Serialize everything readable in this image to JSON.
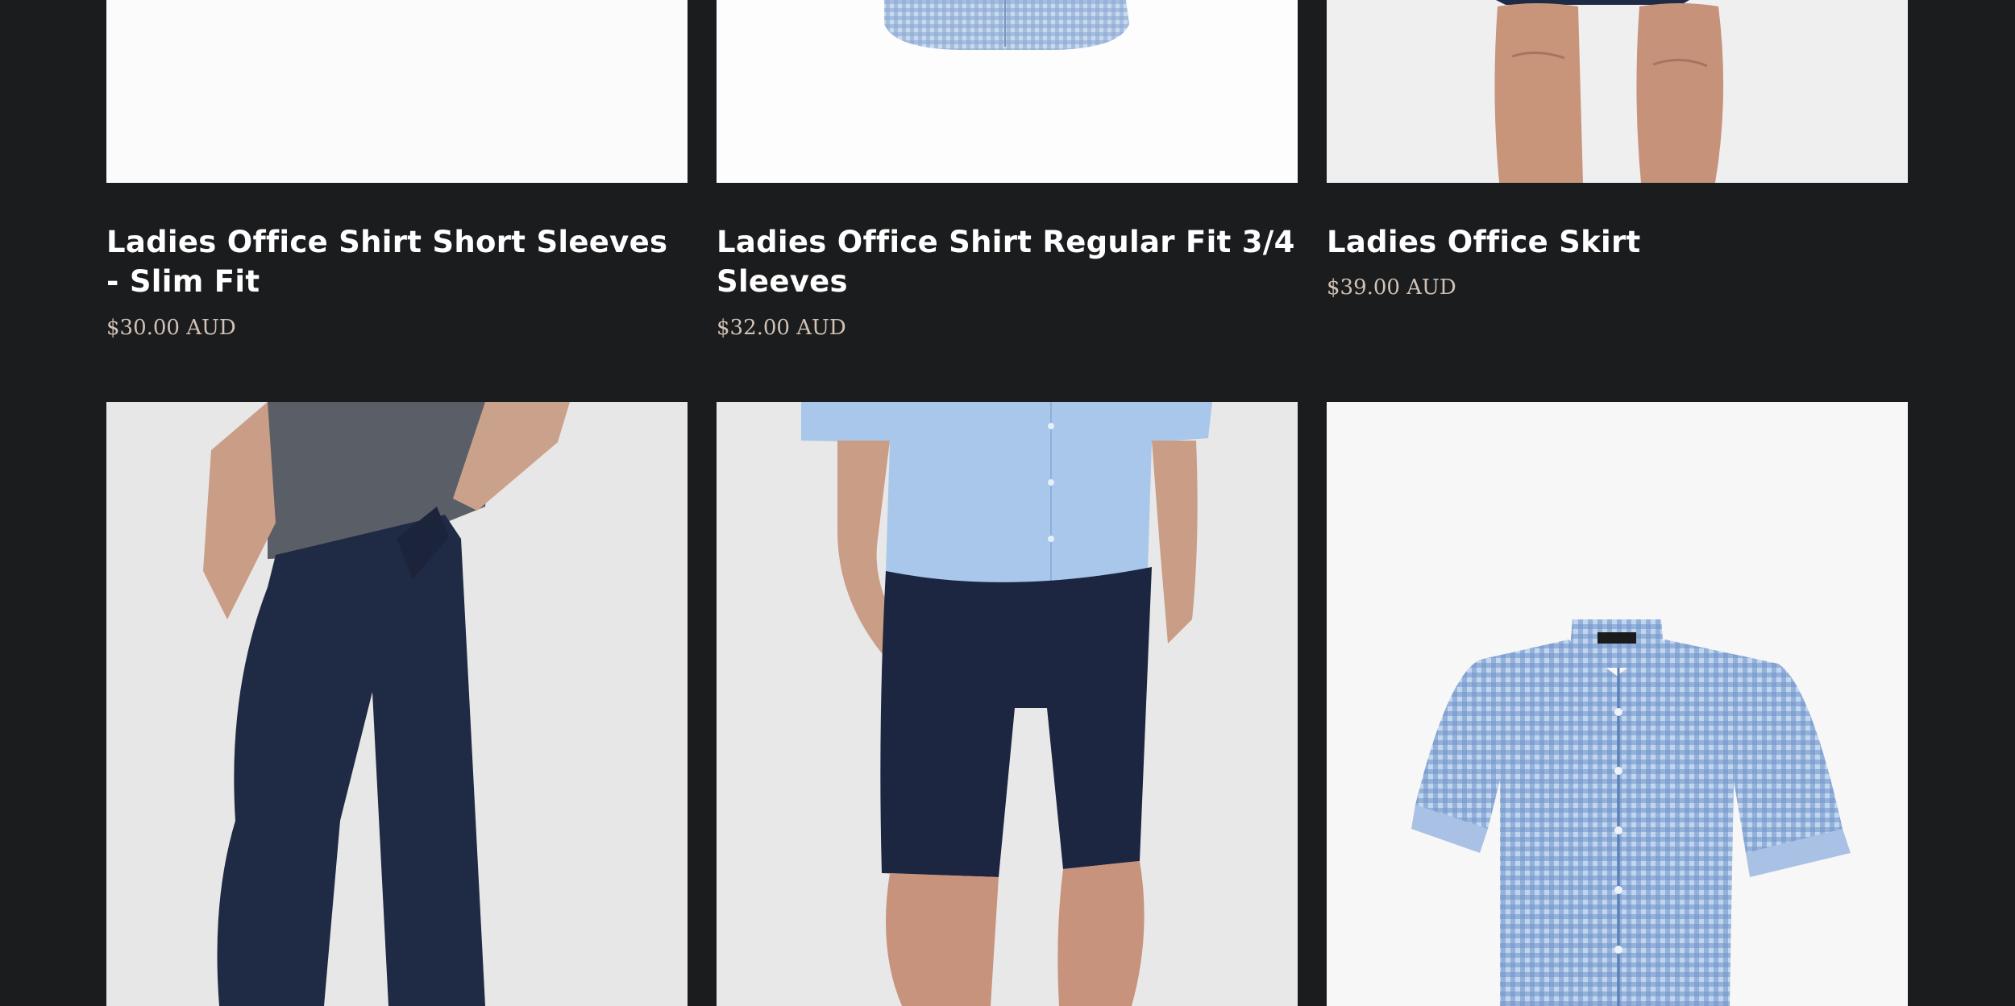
{
  "products": [
    {
      "title": "Ladies Office Shirt Short Sleeves - Slim Fit",
      "price": "$30.00 AUD",
      "image": "product-image-blank"
    },
    {
      "title": "Ladies Office Shirt Regular Fit 3/4 Sleeves",
      "price": "$32.00 AUD",
      "image": "blue-check-shirt-hem"
    },
    {
      "title": "Ladies Office Skirt",
      "price": "$39.00 AUD",
      "image": "model-legs-skirt"
    },
    {
      "image": "navy-pants-grey-top"
    },
    {
      "image": "navy-shorts-light-blue-shirt"
    },
    {
      "image": "blue-check-short-sleeve-shirt"
    }
  ]
}
